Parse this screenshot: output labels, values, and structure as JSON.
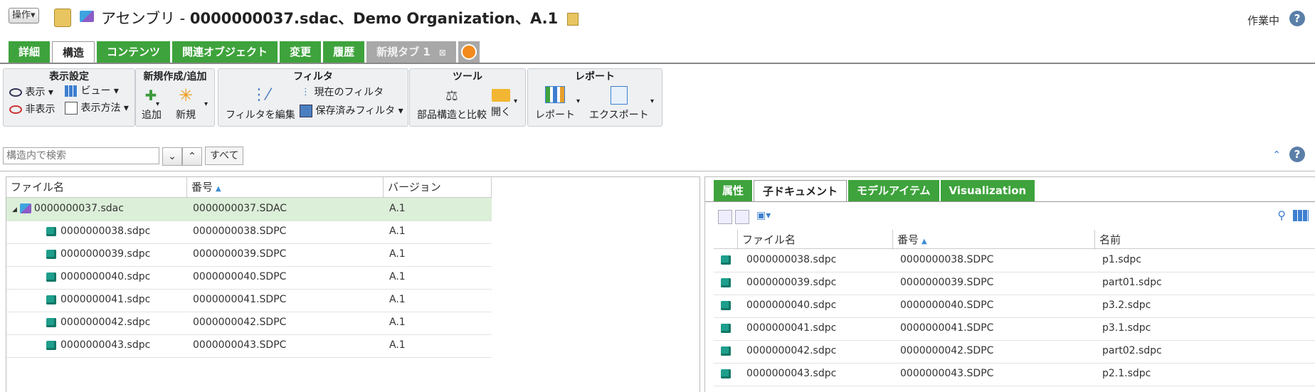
{
  "header": {
    "ops_label": "操作▾",
    "title_prefix": "アセンブリ - ",
    "title_bold": "0000000037.sdac、Demo Organization、A.1",
    "status": "作業中",
    "help": "?"
  },
  "tabs": [
    {
      "label": "詳細"
    },
    {
      "label": "構造"
    },
    {
      "label": "コンテンツ"
    },
    {
      "label": "関連オブジェクト"
    },
    {
      "label": "変更"
    },
    {
      "label": "履歴"
    },
    {
      "label": "新規タブ 1"
    }
  ],
  "ribbon": {
    "display": {
      "title": "表示設定",
      "show": "表示",
      "hide": "非表示",
      "view": "ビュー",
      "method": "表示方法"
    },
    "create": {
      "title": "新規作成/追加",
      "add": "追加",
      "new": "新規"
    },
    "filter": {
      "title": "フィルタ",
      "edit": "フィルタを編集",
      "current": "現在のフィルタ",
      "saved": "保存済みフィルタ"
    },
    "tools": {
      "title": "ツール",
      "compare": "部品構造と比較",
      "open": "開く"
    },
    "report": {
      "title": "レポート",
      "report": "レポート",
      "export": "エクスポート"
    }
  },
  "search": {
    "placeholder": "構造内で検索",
    "all": "すべて"
  },
  "left_grid": {
    "headers": [
      "ファイル名",
      "番号",
      "バージョン"
    ],
    "rows": [
      {
        "name": "0000000037.sdac",
        "number": "0000000037.SDAC",
        "version": "A.1"
      },
      {
        "name": "0000000038.sdpc",
        "number": "0000000038.SDPC",
        "version": "A.1"
      },
      {
        "name": "0000000039.sdpc",
        "number": "0000000039.SDPC",
        "version": "A.1"
      },
      {
        "name": "0000000040.sdpc",
        "number": "0000000040.SDPC",
        "version": "A.1"
      },
      {
        "name": "0000000041.sdpc",
        "number": "0000000041.SDPC",
        "version": "A.1"
      },
      {
        "name": "0000000042.sdpc",
        "number": "0000000042.SDPC",
        "version": "A.1"
      },
      {
        "name": "0000000043.sdpc",
        "number": "0000000043.SDPC",
        "version": "A.1"
      }
    ]
  },
  "right_panel": {
    "tabs": [
      "属性",
      "子ドキュメント",
      "モデルアイテム",
      "Visualization"
    ],
    "headers": [
      "ファイル名",
      "番号",
      "名前"
    ],
    "rows": [
      {
        "name": "0000000038.sdpc",
        "number": "0000000038.SDPC",
        "title": "p1.sdpc"
      },
      {
        "name": "0000000039.sdpc",
        "number": "0000000039.SDPC",
        "title": "part01.sdpc"
      },
      {
        "name": "0000000040.sdpc",
        "number": "0000000040.SDPC",
        "title": "p3.2.sdpc"
      },
      {
        "name": "0000000041.sdpc",
        "number": "0000000041.SDPC",
        "title": "p3.1.sdpc"
      },
      {
        "name": "0000000042.sdpc",
        "number": "0000000042.SDPC",
        "title": "part02.sdpc"
      },
      {
        "name": "0000000043.sdpc",
        "number": "0000000043.SDPC",
        "title": "p2.1.sdpc"
      }
    ]
  },
  "colors": {
    "tab_green": "#3ea33c",
    "selected_row": "#dcefd9",
    "part_icon": "#1e9e8c"
  }
}
